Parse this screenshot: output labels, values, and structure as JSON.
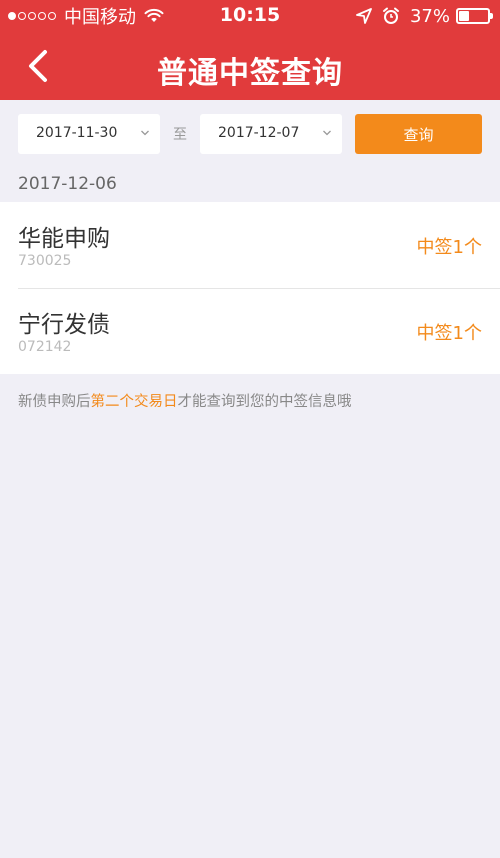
{
  "status_bar": {
    "carrier": "中国移动",
    "time": "10:15",
    "battery_percent": "37%",
    "battery_level": 0.37,
    "signal_bars_filled": 1,
    "signal_bars_total": 5
  },
  "nav": {
    "title": "普通中签查询"
  },
  "filter": {
    "start_date": "2017-11-30",
    "separator": "至",
    "end_date": "2017-12-07",
    "query_label": "查询"
  },
  "results": {
    "group_date": "2017-12-06",
    "items": [
      {
        "name": "华能申购",
        "code": "730025",
        "status": "中签1个"
      },
      {
        "name": "宁行发债",
        "code": "072142",
        "status": "中签1个"
      }
    ]
  },
  "tip": {
    "prefix": "新债申购后",
    "highlight": "第二个交易日",
    "suffix": "才能查询到您的中签信息哦"
  },
  "colors": {
    "header_red": "#e13b3c",
    "accent_orange": "#f38a1b",
    "background": "#f0eff6"
  }
}
